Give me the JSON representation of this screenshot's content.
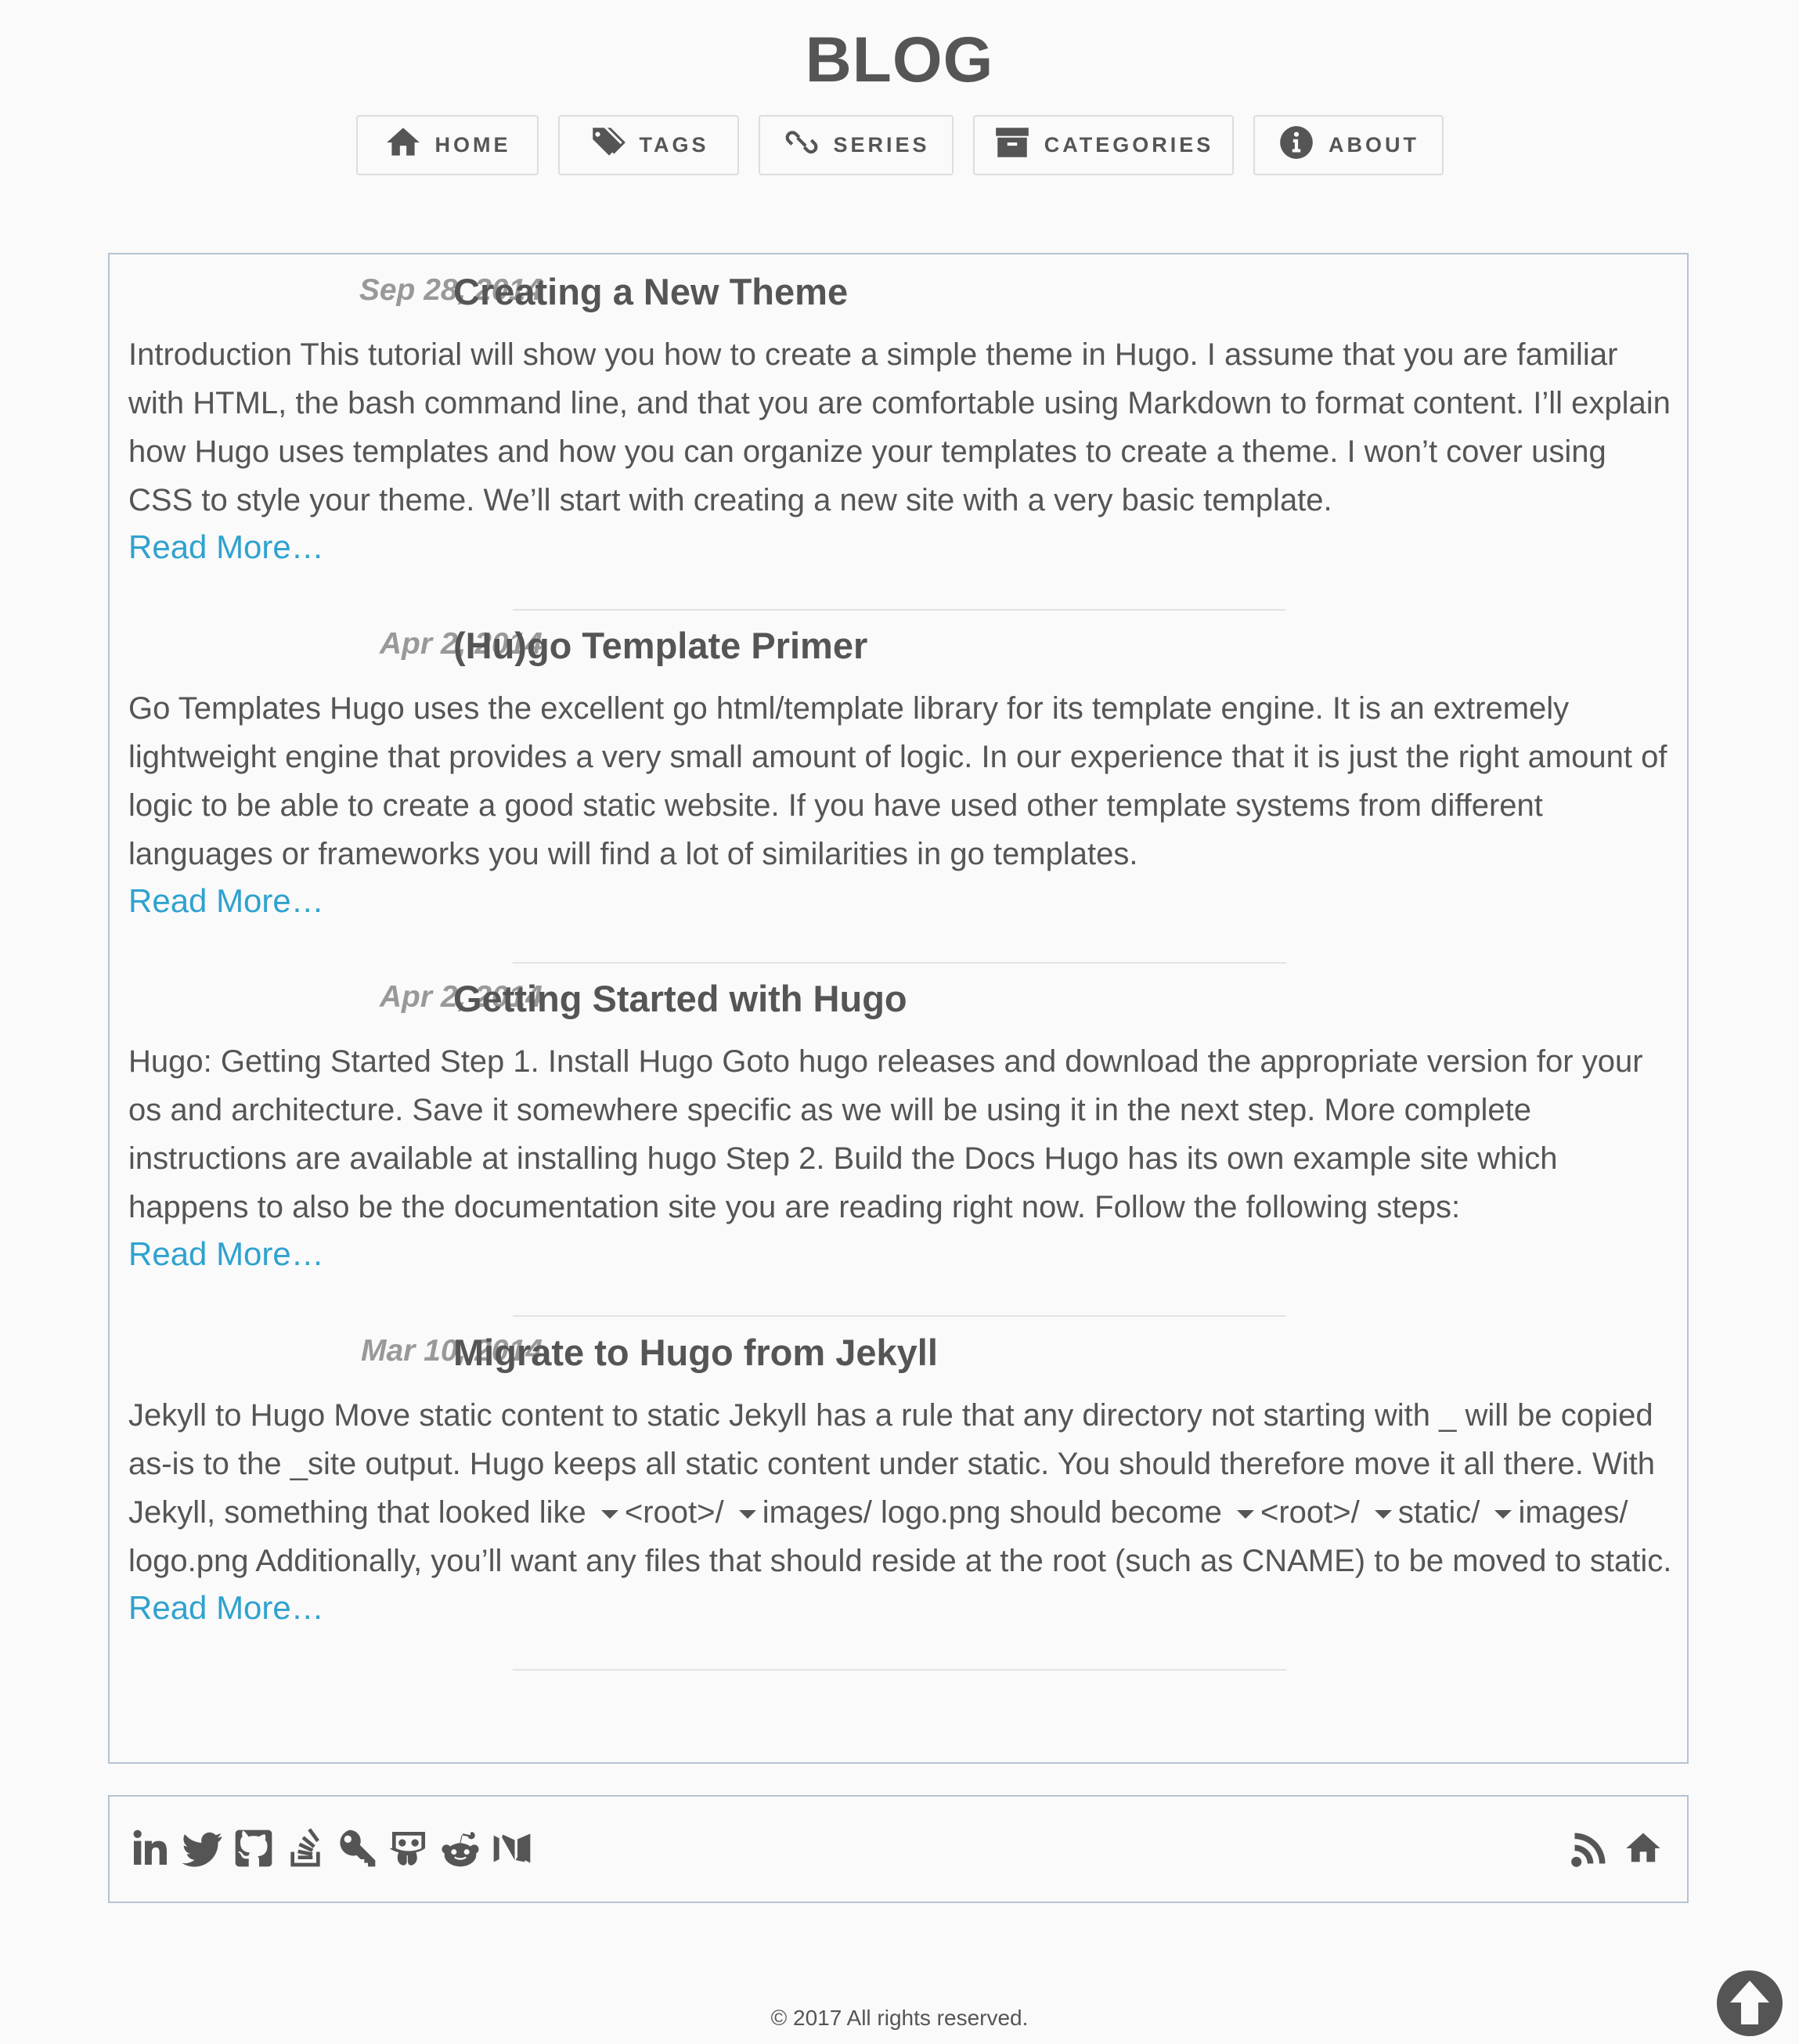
{
  "site": {
    "title": "BLOG"
  },
  "nav": [
    {
      "label": "HOME",
      "icon": "home-icon"
    },
    {
      "label": "TAGS",
      "icon": "tags-icon"
    },
    {
      "label": "SERIES",
      "icon": "link-icon"
    },
    {
      "label": "CATEGORIES",
      "icon": "archive-icon"
    },
    {
      "label": "ABOUT",
      "icon": "info-icon"
    }
  ],
  "posts": [
    {
      "date": "Sep 28, 2014",
      "title": "Creating a New Theme",
      "summary": "Introduction This tutorial will show you how to create a simple theme in Hugo. I assume that you are familiar with HTML, the bash command line, and that you are comfortable using Markdown to format content. I’ll explain how Hugo uses templates and how you can organize your templates to create a theme. I won’t cover using CSS to style your theme. We’ll start with creating a new site with a very basic template.",
      "read_more": "Read More…"
    },
    {
      "date": "Apr 2, 2014",
      "title": "(Hu)go Template Primer",
      "summary": "Go Templates Hugo uses the excellent go html/template library for its template engine. It is an extremely lightweight engine that provides a very small amount of logic. In our experience that it is just the right amount of logic to be able to create a good static website. If you have used other template systems from different languages or frameworks you will find a lot of similarities in go templates.",
      "read_more": "Read More…"
    },
    {
      "date": "Apr 2, 2014",
      "title": "Getting Started with Hugo",
      "summary": "Hugo: Getting Started Step 1. Install Hugo Goto hugo releases and download the appropriate version for your os and architecture. Save it somewhere specific as we will be using it in the next step. More complete instructions are available at installing hugo Step 2. Build the Docs Hugo has its own example site which happens to also be the documentation site you are reading right now. Follow the following steps:",
      "read_more": "Read More…"
    },
    {
      "date": "Mar 10, 2014",
      "title": "Migrate to Hugo from Jekyll",
      "summary_parts": {
        "p1": "Jekyll to Hugo Move static content to static Jekyll has a rule that any directory not starting with _ will be copied as-is to the _site output. Hugo keeps all static content under static. You should therefore move it all there. With Jekyll, something that looked like",
        "p2": "<root>/",
        "p3": "images/ logo.png should become",
        "p4": "<root>/",
        "p5": "static/",
        "p6": "images/ logo.png Additionally, you’ll want any files that should reside at the root (such as CNAME) to be moved to static."
      },
      "read_more": "Read More…"
    }
  ],
  "footer": {
    "social_icons": [
      "linkedin-icon",
      "twitter-icon",
      "github-icon",
      "stackoverflow-icon",
      "keybase-icon",
      "slideshare-icon",
      "reddit-icon",
      "medium-icon"
    ],
    "right_icons": [
      "rss-icon",
      "home-icon"
    ],
    "copyright": "© 2017 All rights reserved."
  },
  "colors": {
    "text": "#555555",
    "date": "#999999",
    "link": "#2fa2cf",
    "border": "#b5c3d1",
    "background": "#fafafa"
  }
}
